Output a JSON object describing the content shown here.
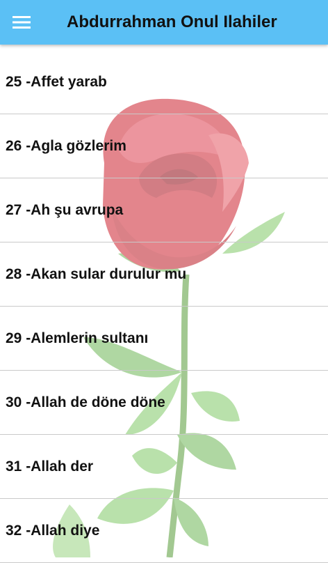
{
  "appbar": {
    "title": "Abdurrahman Onul Ilahiler",
    "menu_icon": "hamburger-menu-icon",
    "color": "#5bc0f5"
  },
  "list": {
    "items": [
      {
        "label": "25 -Affet yarab"
      },
      {
        "label": "26 -Agla gözlerim"
      },
      {
        "label": "27 -Ah şu avrupa"
      },
      {
        "label": "28 -Akan sular durulur mu"
      },
      {
        "label": "29 -Alemlerin sultanı"
      },
      {
        "label": "30 -Allah de döne döne"
      },
      {
        "label": "31 -Allah der"
      },
      {
        "label": "32 -Allah diye"
      }
    ]
  },
  "background": {
    "image": "rose-illustration",
    "accent": "#d23b46"
  }
}
